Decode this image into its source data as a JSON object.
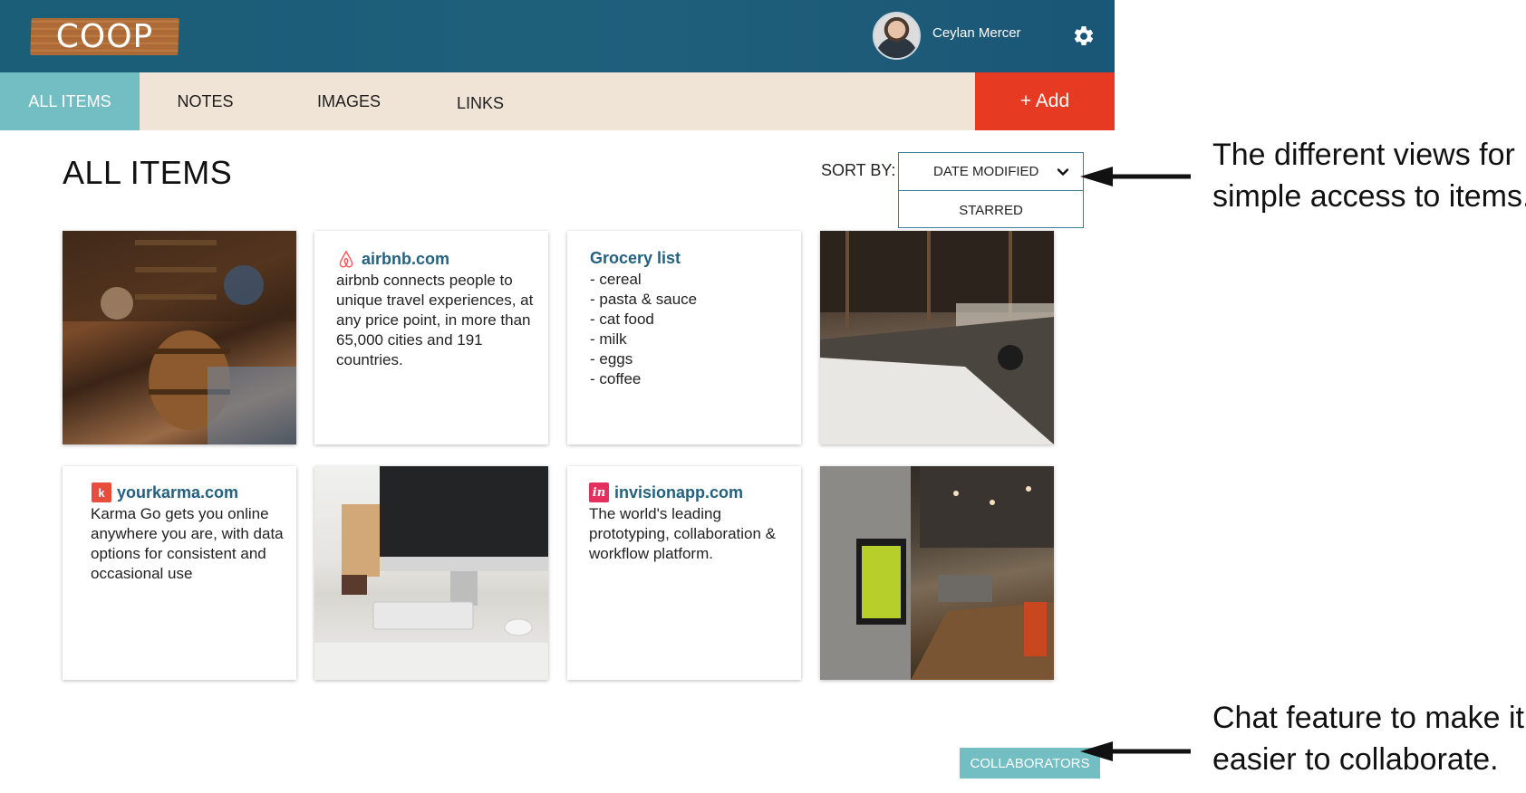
{
  "app": {
    "logo_text": "COOP"
  },
  "header": {
    "user_name": "Ceylan Mercer"
  },
  "nav": {
    "tabs": [
      {
        "label": "ALL ITEMS",
        "active": true
      },
      {
        "label": "NOTES",
        "active": false
      },
      {
        "label": "IMAGES",
        "active": false
      },
      {
        "label": "LINKS",
        "active": false
      }
    ],
    "add_label": "+ Add"
  },
  "main": {
    "title": "ALL ITEMS",
    "sort": {
      "label": "SORT BY:",
      "selected": "DATE MODIFIED",
      "options": [
        "STARRED"
      ]
    }
  },
  "cards": {
    "airbnb": {
      "title": "airbnb.com",
      "text": "airbnb connects people to unique travel experiences, at any price point, in more than 65,000 cities and 191 countries."
    },
    "grocery": {
      "title": "Grocery list",
      "items": [
        "- cereal",
        "- pasta & sauce",
        "- cat food",
        "- milk",
        "- eggs",
        "- coffee"
      ]
    },
    "karma": {
      "title": "yourkarma.com",
      "text": "Karma Go gets you online anywhere you are, with data options for consistent and occasional use"
    },
    "invision": {
      "title": "invisionapp.com",
      "text": "The world's leading prototyping, collaboration & workflow platform."
    }
  },
  "collaborators_label": "COLLABORATORS",
  "annotations": {
    "views": [
      "The different views for",
      "simple access to items."
    ],
    "chat": [
      "Chat feature to make it",
      "easier to collaborate."
    ]
  },
  "colors": {
    "header": "#1f5f7b",
    "nav_bg": "#efe4d6",
    "active_tab": "#73bec3",
    "add_button": "#e63a22",
    "link_title": "#23617f"
  }
}
